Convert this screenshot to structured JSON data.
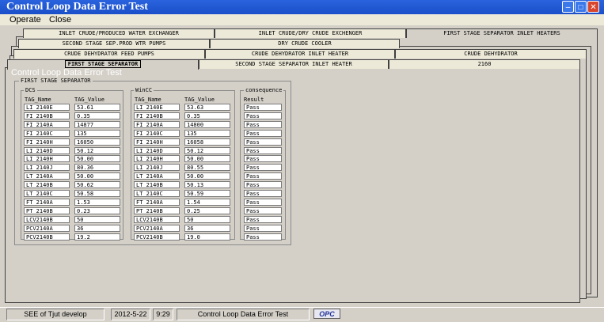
{
  "window": {
    "title": "Control Loop Data Error Test"
  },
  "menu": [
    "Operate",
    "Close"
  ],
  "tabs": {
    "row1": [
      "INLET CRUDE/PRODUCED WATER EXCHANGER",
      "INLET CRUDE/DRY CRUDE EXCHENGER",
      "FIRST STAGE SEPARATOR INLET HEATERS"
    ],
    "row2": [
      "SECOND STAGE SEP.PROD WTR PUMPS",
      "DRY CRUDE COOLER"
    ],
    "row3": [
      "CRUDE DEHYDRATOR FEED PUMPS",
      "CRUDE DEHYDRATOR INLET HEATER",
      "CRUDE DEHYDRATOR"
    ],
    "row4": [
      "FIRST STAGE SEPARATOR",
      "SECOND STAGE SEPARATOR INLET HEATER",
      "2160"
    ]
  },
  "ghost_text": "Control Loop Data Error Test",
  "section": {
    "title": "FIRST STAGE SEPARATOR",
    "dcs": {
      "title": "DCS",
      "col_name": "TAG_Name",
      "col_value": "TAG_Value"
    },
    "wincc": {
      "title": "WinCC",
      "col_name": "TAG_Name",
      "col_value": "TAG_Value"
    },
    "consequence": {
      "title": "consequence",
      "col": "Result"
    },
    "rows": [
      {
        "dcs_name": "LI_2140E",
        "dcs_value": "53.61",
        "wincc_name": "LI_2140E",
        "wincc_value": "53.63",
        "result": "Pass"
      },
      {
        "dcs_name": "FI_2140B",
        "dcs_value": "0.35",
        "wincc_name": "FI_2140B",
        "wincc_value": "0.35",
        "result": "Pass"
      },
      {
        "dcs_name": "FI_2140A",
        "dcs_value": "14877",
        "wincc_name": "FI_2140A",
        "wincc_value": "14800",
        "result": "Pass"
      },
      {
        "dcs_name": "FI_2140C",
        "dcs_value": "135",
        "wincc_name": "FI_2140C",
        "wincc_value": "135",
        "result": "Pass"
      },
      {
        "dcs_name": "FI_2140H",
        "dcs_value": "16050",
        "wincc_name": "FI_2140H",
        "wincc_value": "16058",
        "result": "Pass"
      },
      {
        "dcs_name": "LI_2140D",
        "dcs_value": "50.12",
        "wincc_name": "LI_2140D",
        "wincc_value": "50.12",
        "result": "Pass"
      },
      {
        "dcs_name": "LI_2140H",
        "dcs_value": "50.00",
        "wincc_name": "LI_2140H",
        "wincc_value": "50.00",
        "result": "Pass"
      },
      {
        "dcs_name": "LI_2140J",
        "dcs_value": "80.36",
        "wincc_name": "LI_2140J",
        "wincc_value": "80.55",
        "result": "Pass"
      },
      {
        "dcs_name": "LT_2140A",
        "dcs_value": "50.00",
        "wincc_name": "LT_2140A",
        "wincc_value": "50.00",
        "result": "Pass"
      },
      {
        "dcs_name": "LT_2140B",
        "dcs_value": "50.62",
        "wincc_name": "LT_2140B",
        "wincc_value": "50.13",
        "result": "Pass"
      },
      {
        "dcs_name": "LT_2140C",
        "dcs_value": "50.58",
        "wincc_name": "LT_2140C",
        "wincc_value": "50.59",
        "result": "Pass"
      },
      {
        "dcs_name": "FT_2140A",
        "dcs_value": "1.53",
        "wincc_name": "FT_2140A",
        "wincc_value": "1.54",
        "result": "Pass"
      },
      {
        "dcs_name": "PT_2140B",
        "dcs_value": "0.23",
        "wincc_name": "PT_2140B",
        "wincc_value": "0.25",
        "result": "Pass"
      },
      {
        "dcs_name": "LCV2140B",
        "dcs_value": "50",
        "wincc_name": "LCV2140B",
        "wincc_value": "50",
        "result": "Pass"
      },
      {
        "dcs_name": "PCV2140A",
        "dcs_value": "36",
        "wincc_name": "PCV2140A",
        "wincc_value": "36",
        "result": "Pass"
      },
      {
        "dcs_name": "PCV2140B",
        "dcs_value": "19.2",
        "wincc_name": "PCV2140B",
        "wincc_value": "19.0",
        "result": "Pass"
      }
    ]
  },
  "status": {
    "developer": "SEE of Tjut develop",
    "date": "2012-5-22",
    "time": "9:29",
    "app": "Control Loop Data Error Test",
    "logo": "OPC"
  }
}
